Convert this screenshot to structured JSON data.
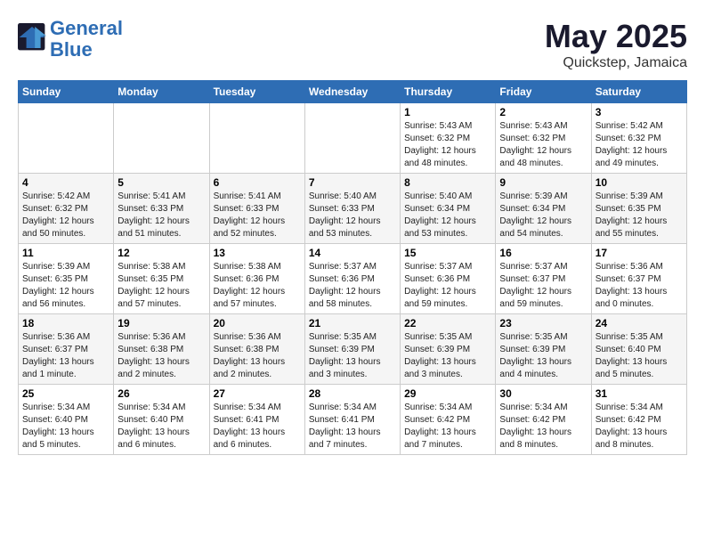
{
  "logo": {
    "line1": "General",
    "line2": "Blue"
  },
  "title": "May 2025",
  "location": "Quickstep, Jamaica",
  "weekdays": [
    "Sunday",
    "Monday",
    "Tuesday",
    "Wednesday",
    "Thursday",
    "Friday",
    "Saturday"
  ],
  "weeks": [
    [
      {
        "day": "",
        "text": ""
      },
      {
        "day": "",
        "text": ""
      },
      {
        "day": "",
        "text": ""
      },
      {
        "day": "",
        "text": ""
      },
      {
        "day": "1",
        "text": "Sunrise: 5:43 AM\nSunset: 6:32 PM\nDaylight: 12 hours\nand 48 minutes."
      },
      {
        "day": "2",
        "text": "Sunrise: 5:43 AM\nSunset: 6:32 PM\nDaylight: 12 hours\nand 48 minutes."
      },
      {
        "day": "3",
        "text": "Sunrise: 5:42 AM\nSunset: 6:32 PM\nDaylight: 12 hours\nand 49 minutes."
      }
    ],
    [
      {
        "day": "4",
        "text": "Sunrise: 5:42 AM\nSunset: 6:32 PM\nDaylight: 12 hours\nand 50 minutes."
      },
      {
        "day": "5",
        "text": "Sunrise: 5:41 AM\nSunset: 6:33 PM\nDaylight: 12 hours\nand 51 minutes."
      },
      {
        "day": "6",
        "text": "Sunrise: 5:41 AM\nSunset: 6:33 PM\nDaylight: 12 hours\nand 52 minutes."
      },
      {
        "day": "7",
        "text": "Sunrise: 5:40 AM\nSunset: 6:33 PM\nDaylight: 12 hours\nand 53 minutes."
      },
      {
        "day": "8",
        "text": "Sunrise: 5:40 AM\nSunset: 6:34 PM\nDaylight: 12 hours\nand 53 minutes."
      },
      {
        "day": "9",
        "text": "Sunrise: 5:39 AM\nSunset: 6:34 PM\nDaylight: 12 hours\nand 54 minutes."
      },
      {
        "day": "10",
        "text": "Sunrise: 5:39 AM\nSunset: 6:35 PM\nDaylight: 12 hours\nand 55 minutes."
      }
    ],
    [
      {
        "day": "11",
        "text": "Sunrise: 5:39 AM\nSunset: 6:35 PM\nDaylight: 12 hours\nand 56 minutes."
      },
      {
        "day": "12",
        "text": "Sunrise: 5:38 AM\nSunset: 6:35 PM\nDaylight: 12 hours\nand 57 minutes."
      },
      {
        "day": "13",
        "text": "Sunrise: 5:38 AM\nSunset: 6:36 PM\nDaylight: 12 hours\nand 57 minutes."
      },
      {
        "day": "14",
        "text": "Sunrise: 5:37 AM\nSunset: 6:36 PM\nDaylight: 12 hours\nand 58 minutes."
      },
      {
        "day": "15",
        "text": "Sunrise: 5:37 AM\nSunset: 6:36 PM\nDaylight: 12 hours\nand 59 minutes."
      },
      {
        "day": "16",
        "text": "Sunrise: 5:37 AM\nSunset: 6:37 PM\nDaylight: 12 hours\nand 59 minutes."
      },
      {
        "day": "17",
        "text": "Sunrise: 5:36 AM\nSunset: 6:37 PM\nDaylight: 13 hours\nand 0 minutes."
      }
    ],
    [
      {
        "day": "18",
        "text": "Sunrise: 5:36 AM\nSunset: 6:37 PM\nDaylight: 13 hours\nand 1 minute."
      },
      {
        "day": "19",
        "text": "Sunrise: 5:36 AM\nSunset: 6:38 PM\nDaylight: 13 hours\nand 2 minutes."
      },
      {
        "day": "20",
        "text": "Sunrise: 5:36 AM\nSunset: 6:38 PM\nDaylight: 13 hours\nand 2 minutes."
      },
      {
        "day": "21",
        "text": "Sunrise: 5:35 AM\nSunset: 6:39 PM\nDaylight: 13 hours\nand 3 minutes."
      },
      {
        "day": "22",
        "text": "Sunrise: 5:35 AM\nSunset: 6:39 PM\nDaylight: 13 hours\nand 3 minutes."
      },
      {
        "day": "23",
        "text": "Sunrise: 5:35 AM\nSunset: 6:39 PM\nDaylight: 13 hours\nand 4 minutes."
      },
      {
        "day": "24",
        "text": "Sunrise: 5:35 AM\nSunset: 6:40 PM\nDaylight: 13 hours\nand 5 minutes."
      }
    ],
    [
      {
        "day": "25",
        "text": "Sunrise: 5:34 AM\nSunset: 6:40 PM\nDaylight: 13 hours\nand 5 minutes."
      },
      {
        "day": "26",
        "text": "Sunrise: 5:34 AM\nSunset: 6:40 PM\nDaylight: 13 hours\nand 6 minutes."
      },
      {
        "day": "27",
        "text": "Sunrise: 5:34 AM\nSunset: 6:41 PM\nDaylight: 13 hours\nand 6 minutes."
      },
      {
        "day": "28",
        "text": "Sunrise: 5:34 AM\nSunset: 6:41 PM\nDaylight: 13 hours\nand 7 minutes."
      },
      {
        "day": "29",
        "text": "Sunrise: 5:34 AM\nSunset: 6:42 PM\nDaylight: 13 hours\nand 7 minutes."
      },
      {
        "day": "30",
        "text": "Sunrise: 5:34 AM\nSunset: 6:42 PM\nDaylight: 13 hours\nand 8 minutes."
      },
      {
        "day": "31",
        "text": "Sunrise: 5:34 AM\nSunset: 6:42 PM\nDaylight: 13 hours\nand 8 minutes."
      }
    ]
  ]
}
